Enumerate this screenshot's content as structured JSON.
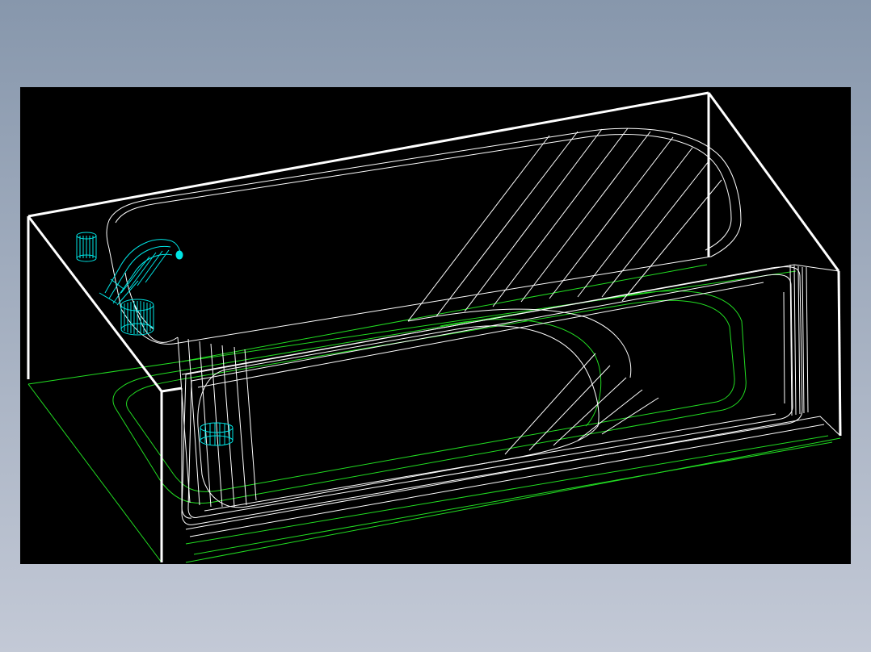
{
  "background": {
    "top_color": "#8797ac",
    "bottom_color": "#c3c9d6"
  },
  "viewport": {
    "background_color": "#000000"
  },
  "model": {
    "subject": "bathtub-wireframe",
    "colors": {
      "outer_edges": "#ffffff",
      "inner_edges": "#ffffff",
      "bottom_contour": "#22dd22",
      "fittings": "#00e5e5"
    },
    "icons": {
      "faucet": "faucet-icon",
      "valve": "valve-icon",
      "drain": "drain-icon"
    }
  }
}
